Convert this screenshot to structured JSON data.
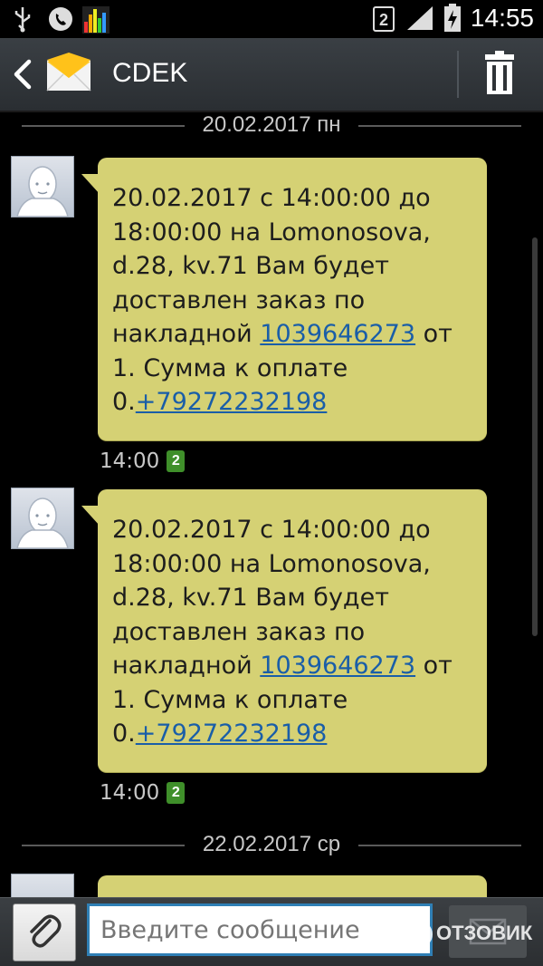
{
  "status_bar": {
    "time": "14:55",
    "sim_slot": "2",
    "icons": [
      "usb-icon",
      "phone-call-icon",
      "equalizer-app-icon",
      "sim-2-icon",
      "signal-icon",
      "battery-charging-icon"
    ]
  },
  "header": {
    "contact_name": "CDEK",
    "icons": [
      "back-arrow-icon",
      "envelope-icon",
      "trash-icon"
    ]
  },
  "dates": [
    "20.02.2017 пн",
    "22.02.2017 ср"
  ],
  "messages": [
    {
      "text_before": "20.02.2017 с 14:00:00 до 18:00:00 на Lomonosova, d.28, kv.71 Вам будет доставлен заказ по накладной ",
      "tracking_number": "1039646273",
      "text_middle": " от 1. Сумма к оплате 0.",
      "phone": "+79272232198",
      "time": "14:00",
      "sim": "2"
    },
    {
      "text_before": "20.02.2017 с 14:00:00 до 18:00:00 на Lomonosova, d.28, kv.71 Вам будет доставлен заказ по накладной ",
      "tracking_number": "1039646273",
      "text_middle": " от 1. Сумма к оплате 0.",
      "phone": "+79272232198",
      "time": "14:00",
      "sim": "2"
    }
  ],
  "composer": {
    "placeholder": "Введите сообщение",
    "icons": [
      "paperclip-icon",
      "send-message-icon"
    ]
  },
  "watermark": "ОТЗОВИК",
  "colors": {
    "bubble": "#d5d174",
    "link": "#1a5ea8",
    "action_bar": "#2f3337",
    "input_border": "#2f7fb5"
  }
}
